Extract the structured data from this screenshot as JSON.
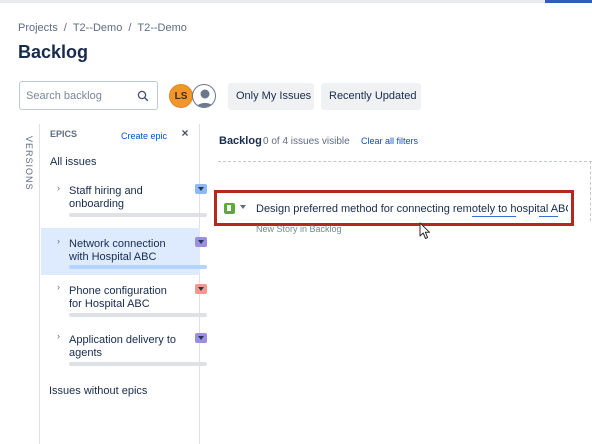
{
  "breadcrumb": {
    "items": [
      "Projects",
      "T2--Demo",
      "T2--Demo"
    ],
    "separator": "/"
  },
  "page": {
    "title": "Backlog"
  },
  "search": {
    "placeholder": "Search backlog",
    "icon": "search-icon"
  },
  "avatars": {
    "initials": "LS",
    "ls_color": "#f0962d"
  },
  "filters": {
    "only_my_issues": "Only My Issues",
    "recently_updated": "Recently Updated"
  },
  "sidebar": {
    "versions_label": "VERSIONS",
    "epics_label": "EPICS",
    "create_epic": "Create epic",
    "close_icon": "close-icon",
    "all_issues": "All issues",
    "epics": [
      {
        "name": "Staff hiring and onboarding",
        "color": "#8fb8f6",
        "selected": false
      },
      {
        "name": "Network connection with Hospital ABC",
        "color": "#9d8fe0",
        "selected": true
      },
      {
        "name": "Phone configuration for Hospital ABC",
        "color": "#f2988c",
        "selected": false
      },
      {
        "name": "Application delivery to agents",
        "color": "#9d8fe0",
        "selected": false
      }
    ],
    "issues_without_epics": "Issues without epics"
  },
  "backlog": {
    "title": "Backlog",
    "count": "0 of 4 issues visible",
    "clear_filters": "Clear all filters",
    "new_issue": {
      "value": "Design preferred method for connecting remotely to hospital ABC",
      "hint": "New Story in Backlog",
      "type_icon": "story-icon",
      "highlight_color": "#b4281e"
    }
  },
  "colors": {
    "accent_link": "#0052cc",
    "selected_bg": "#deebff",
    "story_green": "#5aab3a"
  }
}
